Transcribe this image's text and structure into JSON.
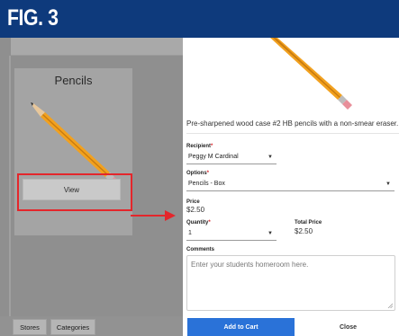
{
  "figure": {
    "label": "FIG. 3"
  },
  "store": {
    "card": {
      "title": "Pencils",
      "view_label": "View"
    },
    "tabs": [
      {
        "label": "Stores"
      },
      {
        "label": "Categories"
      }
    ]
  },
  "product": {
    "description": "Pre-sharpened wood case #2 HB pencils with a non-smear eraser.",
    "recipient": {
      "label": "Recipient",
      "value": "Peggy M Cardinal"
    },
    "options": {
      "label": "Options",
      "value": "Pencils - Box"
    },
    "price": {
      "label": "Price",
      "value": "$2.50"
    },
    "quantity": {
      "label": "Quantity",
      "value": "1"
    },
    "total_price": {
      "label": "Total Price",
      "value": "$2.50"
    },
    "comments": {
      "label": "Comments",
      "placeholder": "Enter your students homeroom here."
    },
    "required_marker": "*"
  },
  "actions": {
    "add_to_cart": "Add to Cart",
    "close": "Close"
  },
  "colors": {
    "banner": "#0e3a7c",
    "highlight": "#e4262b",
    "primary_button": "#2a72d8",
    "required": "#d9252a"
  },
  "icons": {
    "pencil": "pencil-icon",
    "dropdown": "chevron-down-icon",
    "arrow": "arrow-right-icon",
    "resize": "resize-grip-icon"
  }
}
